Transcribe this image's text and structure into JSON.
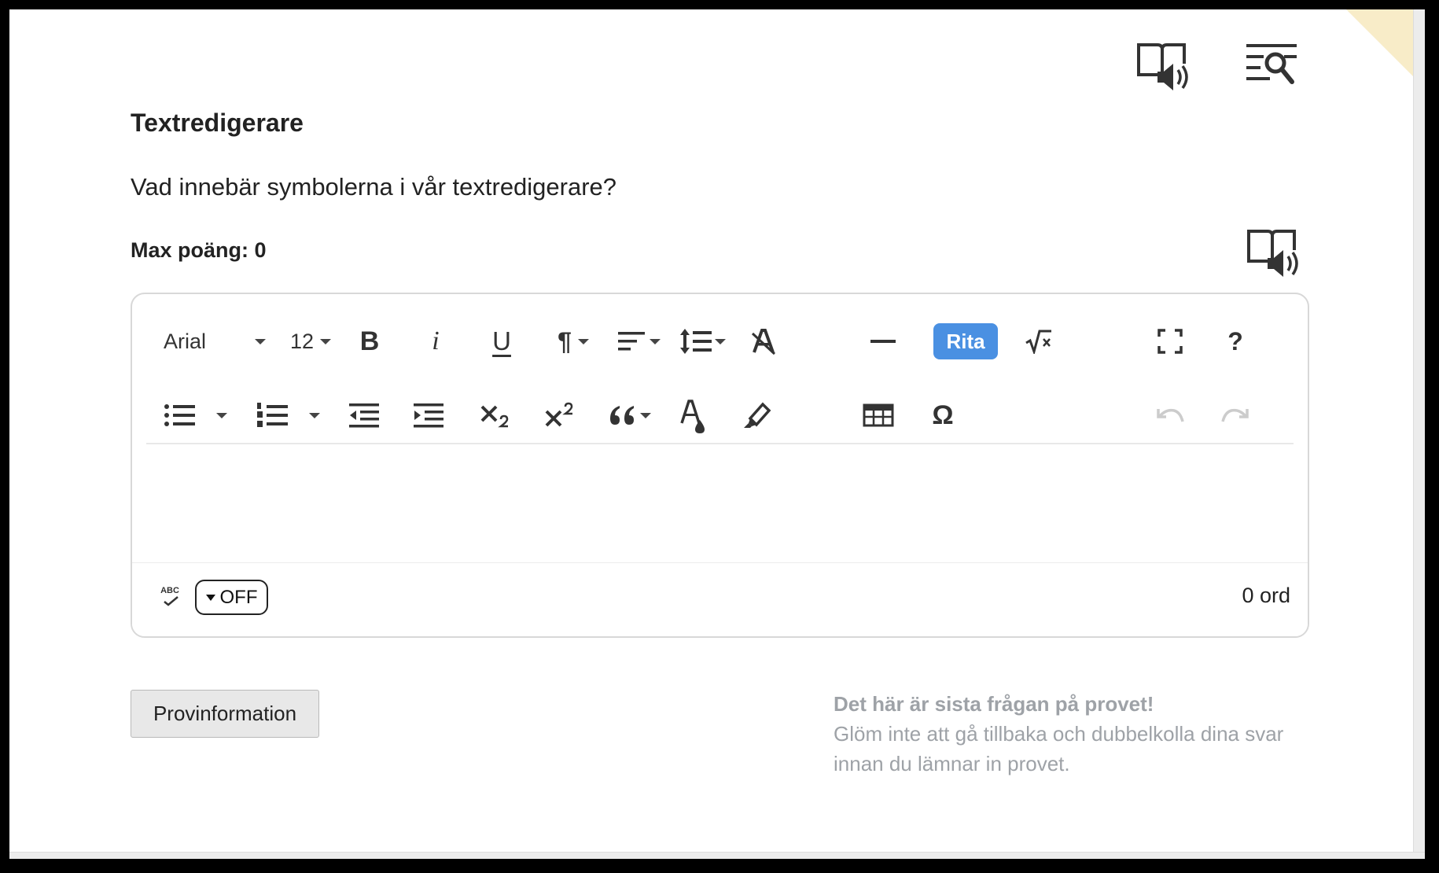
{
  "header": {
    "read_aloud_icon": "book-speaker-icon",
    "text_search_icon": "text-search-icon"
  },
  "question": {
    "title": "Textredigerare",
    "text": "Vad innebär symbolerna i vår textredigerare?",
    "max_points": "Max poäng: 0",
    "read_aloud_icon": "book-speaker-icon"
  },
  "editor": {
    "toolbar_row1": {
      "font_family": "Arial",
      "font_size": "12",
      "bold": "B",
      "italic": "i",
      "underline": "U",
      "paragraph": "¶",
      "draw_button": "Rita",
      "help": "?"
    },
    "toolbar_row2": {
      "special_chars": "Ω"
    },
    "status": {
      "spellcheck_label": "ABC",
      "spellcheck_toggle": "OFF",
      "word_count": "0 ord"
    }
  },
  "footer": {
    "info_button": "Provinformation",
    "last_question_title": "Det här är sista frågan på provet!",
    "last_question_text": "Glöm inte att gå tillbaka och dubbelkolla dina svar innan du lämnar in provet."
  },
  "colors": {
    "accent": "#4a90e2",
    "muted_text": "#9ea2a7",
    "corner_fold": "#f8ecc8"
  }
}
